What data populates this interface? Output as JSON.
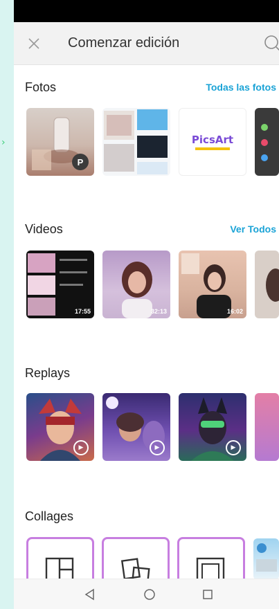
{
  "header": {
    "title": "Comenzar edición"
  },
  "sections": {
    "photos": {
      "title": "Fotos",
      "see_all": "Todas las fotos"
    },
    "videos": {
      "title": "Videos",
      "see_all": "Ver Todos",
      "durations": [
        "17:55",
        "32:13",
        "16:02"
      ]
    },
    "replays": {
      "title": "Replays"
    },
    "collages": {
      "title": "Collages"
    }
  },
  "photo_badge": "P",
  "picsart_logo": "PicsArt",
  "icons": [
    "close-icon",
    "search-icon",
    "replay-icon",
    "collage-grid-icon",
    "collage-free-icon",
    "collage-frame-icon",
    "nav-back-icon",
    "nav-home-icon",
    "nav-recents-icon"
  ],
  "colors": {
    "accent": "#1aa3d6",
    "collage_border": "#c77ee0"
  }
}
